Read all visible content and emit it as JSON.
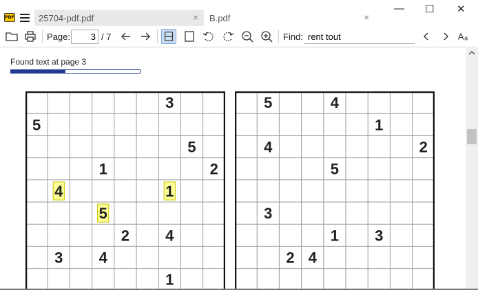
{
  "tabs": [
    {
      "label": "25704-pdf.pdf",
      "close": "×"
    },
    {
      "label": "B.pdf",
      "close": "×"
    }
  ],
  "app_icon": "PDF",
  "window_controls": {
    "minimize": "—",
    "maximize": "☐",
    "close": "✕"
  },
  "toolbar": {
    "page_label": "Page:",
    "page_value": "3",
    "page_total": "/ 7",
    "find_label": "Find:",
    "find_value": "rent tout"
  },
  "icons": {
    "open": "folder-icon",
    "print": "printer-icon",
    "prev": "arrow-left-icon",
    "next": "arrow-right-icon",
    "continuous": "continuous-page-icon",
    "single": "single-page-icon",
    "rotate_left": "rotate-left-icon",
    "rotate_right": "rotate-right-icon",
    "zoom_out": "zoom-out-icon",
    "zoom_in": "zoom-in-icon",
    "find_prev": "chevron-left-icon",
    "find_next": "chevron-right-icon",
    "match_case": "match-case-icon"
  },
  "status": {
    "text": "Found text at page 3",
    "progress": 0.42
  },
  "colors": {
    "highlight": "#ffff99",
    "progress": "#1f3a93",
    "active_button": "#cce0f5"
  },
  "puzzles": {
    "left": {
      "cells": [
        {
          "row": 0,
          "col": 6,
          "v": "3"
        },
        {
          "row": 1,
          "col": 0,
          "v": "5"
        },
        {
          "row": 2,
          "col": 7,
          "v": "5"
        },
        {
          "row": 3,
          "col": 3,
          "v": "1"
        },
        {
          "row": 3,
          "col": 8,
          "v": "2"
        },
        {
          "row": 4,
          "col": 1,
          "v": "4",
          "hl": true
        },
        {
          "row": 4,
          "col": 6,
          "v": "1",
          "hl": true
        },
        {
          "row": 5,
          "col": 3,
          "v": "5",
          "hl": true
        },
        {
          "row": 6,
          "col": 4,
          "v": "2"
        },
        {
          "row": 6,
          "col": 6,
          "v": "4"
        },
        {
          "row": 7,
          "col": 1,
          "v": "3"
        },
        {
          "row": 7,
          "col": 3,
          "v": "4"
        },
        {
          "row": 8,
          "col": 6,
          "v": "1"
        }
      ]
    },
    "right": {
      "cells": [
        {
          "row": 0,
          "col": 1,
          "v": "5"
        },
        {
          "row": 0,
          "col": 4,
          "v": "4"
        },
        {
          "row": 1,
          "col": 6,
          "v": "1"
        },
        {
          "row": 2,
          "col": 1,
          "v": "4"
        },
        {
          "row": 2,
          "col": 8,
          "v": "2"
        },
        {
          "row": 3,
          "col": 4,
          "v": "5"
        },
        {
          "row": 5,
          "col": 1,
          "v": "3"
        },
        {
          "row": 6,
          "col": 4,
          "v": "1"
        },
        {
          "row": 6,
          "col": 6,
          "v": "3"
        },
        {
          "row": 7,
          "col": 2,
          "v": "2"
        },
        {
          "row": 7,
          "col": 3,
          "v": "4"
        }
      ]
    }
  }
}
